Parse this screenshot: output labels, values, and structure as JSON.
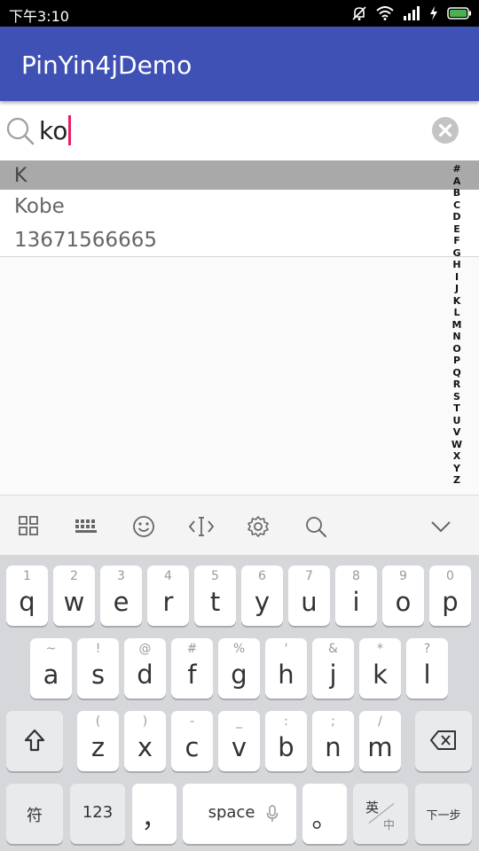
{
  "status_bar": {
    "time": "下午3:10",
    "icons": [
      "mute-icon",
      "wifi-icon",
      "signal-icon",
      "charging-icon",
      "battery-icon"
    ],
    "battery_color": "#4caf50"
  },
  "app_bar": {
    "title": "PinYin4jDemo",
    "color": "#3f51b5"
  },
  "search": {
    "value": "ko",
    "icons": [
      "search-icon",
      "clear-icon"
    ]
  },
  "list": {
    "section_letter": "K",
    "contacts": [
      {
        "name": "Kobe",
        "phone": "13671566665"
      }
    ]
  },
  "side_index": [
    "#",
    "A",
    "B",
    "C",
    "D",
    "E",
    "F",
    "G",
    "H",
    "I",
    "J",
    "K",
    "L",
    "M",
    "N",
    "O",
    "P",
    "Q",
    "R",
    "S",
    "T",
    "U",
    "V",
    "W",
    "X",
    "Y",
    "Z"
  ],
  "keyboard_toolbar": {
    "icons": [
      "grid-icon",
      "keyboard-icon",
      "emoji-icon",
      "cursor-icon",
      "gear-icon",
      "search-icon",
      "chevron-down-icon"
    ]
  },
  "keyboard": {
    "row1": [
      {
        "key": "q",
        "hint": "1"
      },
      {
        "key": "w",
        "hint": "2"
      },
      {
        "key": "e",
        "hint": "3"
      },
      {
        "key": "r",
        "hint": "4"
      },
      {
        "key": "t",
        "hint": "5"
      },
      {
        "key": "y",
        "hint": "6"
      },
      {
        "key": "u",
        "hint": "7"
      },
      {
        "key": "i",
        "hint": "8"
      },
      {
        "key": "o",
        "hint": "9"
      },
      {
        "key": "p",
        "hint": "0"
      }
    ],
    "row2": [
      {
        "key": "a",
        "hint": "~"
      },
      {
        "key": "s",
        "hint": "!"
      },
      {
        "key": "d",
        "hint": "@"
      },
      {
        "key": "f",
        "hint": "#"
      },
      {
        "key": "g",
        "hint": "%"
      },
      {
        "key": "h",
        "hint": "'"
      },
      {
        "key": "j",
        "hint": "&"
      },
      {
        "key": "k",
        "hint": "*"
      },
      {
        "key": "l",
        "hint": "?"
      }
    ],
    "row3": [
      {
        "key": "z",
        "hint": "("
      },
      {
        "key": "x",
        "hint": ")"
      },
      {
        "key": "c",
        "hint": "-"
      },
      {
        "key": "v",
        "hint": "_"
      },
      {
        "key": "b",
        "hint": ":"
      },
      {
        "key": "n",
        "hint": ";"
      },
      {
        "key": "m",
        "hint": "/"
      }
    ],
    "symbols_key": "符",
    "numbers_key": "123",
    "comma_key": "，",
    "space_key": "space",
    "period_key": "。",
    "lang_top": "英",
    "lang_bottom": "中",
    "enter_key": "下一步"
  }
}
